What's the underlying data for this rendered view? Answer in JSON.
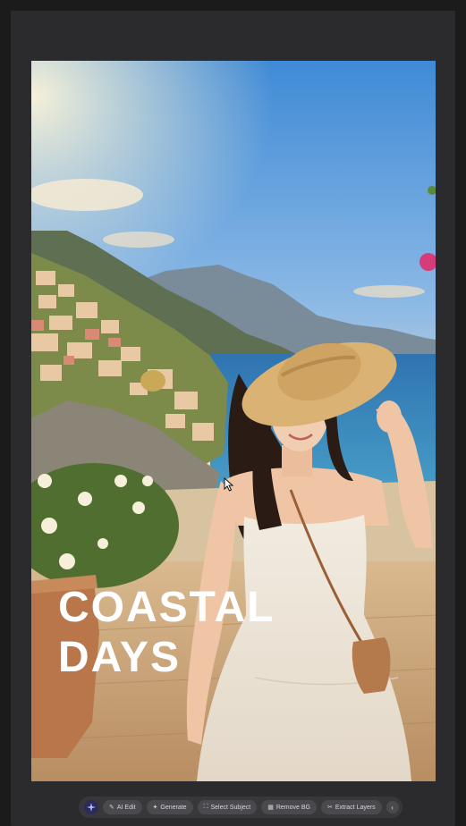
{
  "poster": {
    "headline_line1": "COASTAL",
    "headline_line2": "DAYS"
  },
  "toolbar": {
    "logo_icon": "sparkle-logo-icon",
    "buttons": [
      {
        "label": "AI Edit",
        "icon": "magic-wand-icon"
      },
      {
        "label": "Generate",
        "icon": "sparkle-icon"
      },
      {
        "label": "Select Subject",
        "icon": "select-subject-icon"
      },
      {
        "label": "Remove BG",
        "icon": "remove-bg-icon"
      },
      {
        "label": "Extract Layers",
        "icon": "layers-icon"
      }
    ],
    "collapse_icon": "chevron-left-icon"
  },
  "colors": {
    "background": "#1b1b1c",
    "panel": "#2b2b2d",
    "toolbar": "#38383b",
    "headline": "#ffffff"
  }
}
